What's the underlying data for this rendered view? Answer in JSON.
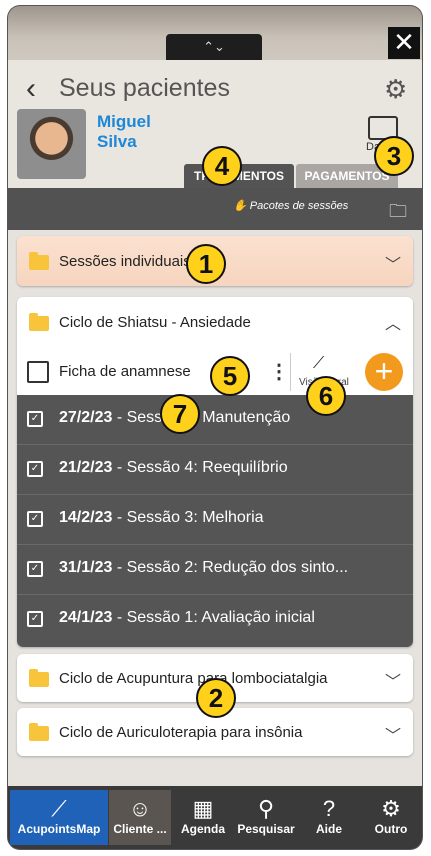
{
  "window": {
    "close_glyph": "✕",
    "handle_glyph": "⌃⌄"
  },
  "header": {
    "title": "Seus pacientes",
    "back_glyph": "‹",
    "settings_icon": "gear-icon"
  },
  "patient": {
    "first_name": "Miguel",
    "last_name": "Silva",
    "dados_label": "Dados"
  },
  "tabs": [
    {
      "label": "TRATAMENTOS"
    },
    {
      "label": "PAGAMENTOS"
    }
  ],
  "toolbar": {
    "packages_label": "Pacotes de sessões"
  },
  "folders": [
    {
      "label": "Sessões individuais",
      "state": "collapsed"
    },
    {
      "label": "Ciclo de Shiatsu - Ansiedade",
      "state": "expanded"
    },
    {
      "label": "Ciclo de Acupuntura para lombociatalgia",
      "state": "collapsed"
    },
    {
      "label": "Ciclo de Auriculoterapia para insônia",
      "state": "collapsed"
    }
  ],
  "expanded": {
    "anamnesis_label": "Ficha de anamnese",
    "overview_label": "Visão geral"
  },
  "sessions": [
    {
      "date": "27/2/23",
      "title": "Sessão 5: Manutenção"
    },
    {
      "date": "21/2/23",
      "title": "Sessão 4: Reequilíbrio"
    },
    {
      "date": "14/2/23",
      "title": "Sessão 3: Melhoria"
    },
    {
      "date": "31/1/23",
      "title": "Sessão 2: Redução dos sinto..."
    },
    {
      "date": "24/1/23",
      "title": "Sessão 1: Avaliação inicial"
    }
  ],
  "badges": [
    "1",
    "2",
    "3",
    "4",
    "5",
    "6",
    "7"
  ],
  "tabbar": [
    {
      "label": "AcupointsMap",
      "icon": "needle-icon"
    },
    {
      "label": "Cliente ...",
      "icon": "client-face-icon"
    },
    {
      "label": "Agenda",
      "icon": "calendar-icon"
    },
    {
      "label": "Pesquisar",
      "icon": "search-icon"
    },
    {
      "label": "Aide",
      "icon": "help-icon"
    },
    {
      "label": "Outro",
      "icon": "gear-icon"
    }
  ],
  "colors": {
    "accent": "#f29a1e",
    "brand_blue": "#1f62b8",
    "name_blue": "#1e88d8",
    "folder": "#f7c43b",
    "badge": "#ffd11a"
  }
}
